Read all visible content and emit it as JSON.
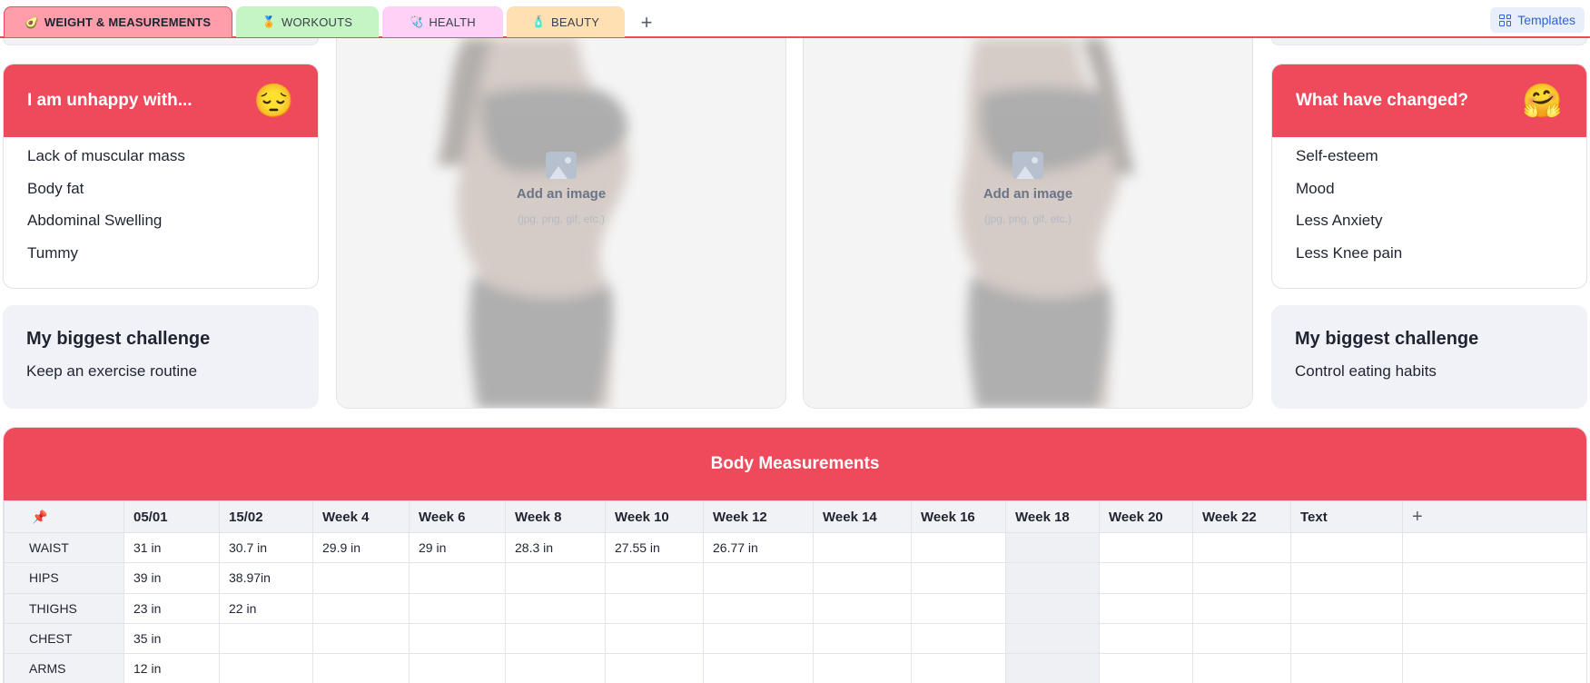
{
  "tabs": [
    {
      "label": "WEIGHT & MEASUREMENTS",
      "icon": "avocado-icon",
      "glyph": "🥑",
      "color": "#ff9dab",
      "active": true
    },
    {
      "label": "WORKOUTS",
      "icon": "medal-icon",
      "glyph": "🏅",
      "color": "#c6f5c5",
      "active": false
    },
    {
      "label": "HEALTH",
      "icon": "stethoscope-icon",
      "glyph": "🩺",
      "color": "#ffd1f6",
      "active": false
    },
    {
      "label": "BEAUTY",
      "icon": "lotion-icon",
      "glyph": "🧴",
      "color": "#ffe0b3",
      "active": false
    }
  ],
  "tab_add": "+",
  "templates_label": "Templates",
  "left": {
    "unhappy": {
      "title": "I am unhappy with...",
      "emoji": "😔",
      "items": [
        "Lack of muscular mass",
        "Body fat",
        "Abdominal Swelling",
        "Tummy"
      ]
    },
    "challenge": {
      "title": "My biggest challenge",
      "text": "Keep an exercise routine"
    }
  },
  "right": {
    "changed": {
      "title": "What have changed?",
      "emoji": "🤗",
      "items": [
        "Self-esteem",
        "Mood",
        "Less Anxiety",
        "Less Knee pain"
      ]
    },
    "challenge": {
      "title": "My biggest challenge",
      "text": "Control eating habits"
    }
  },
  "photo_placeholder": {
    "add": "Add an image",
    "formats": "(jpg, png, gif, etc.)"
  },
  "measurements": {
    "title": "Body Measurements",
    "pin": "📌",
    "columns": [
      "05/01",
      "15/02",
      "Week 4",
      "Week 6",
      "Week 8",
      "Week 10",
      "Week 12",
      "Week 14",
      "Week 16",
      "Week 18",
      "Week 20",
      "Week 22",
      "Text"
    ],
    "add_column": "+",
    "rows": [
      {
        "label": "WAIST",
        "cells": [
          "31 in",
          "30.7 in",
          "29.9 in",
          "29 in",
          "28.3 in",
          "27.55 in",
          "26.77 in",
          "",
          "",
          "",
          "",
          "",
          ""
        ]
      },
      {
        "label": "HIPS",
        "cells": [
          "39 in",
          "38.97in",
          "",
          "",
          "",
          "",
          "",
          "",
          "",
          "",
          "",
          "",
          ""
        ]
      },
      {
        "label": "THIGHS",
        "cells": [
          "23 in",
          "22 in",
          "",
          "",
          "",
          "",
          "",
          "",
          "",
          "",
          "",
          "",
          ""
        ]
      },
      {
        "label": "CHEST",
        "cells": [
          "35 in",
          "",
          "",
          "",
          "",
          "",
          "",
          "",
          "",
          "",
          "",
          "",
          ""
        ]
      },
      {
        "label": "ARMS",
        "cells": [
          "12 in",
          "",
          "",
          "",
          "",
          "",
          "",
          "",
          "",
          "",
          "",
          "",
          ""
        ]
      },
      {
        "label": "",
        "cells": [
          "",
          "",
          "",
          "",
          "",
          "",
          "",
          "",
          "",
          "",
          "",
          "",
          ""
        ]
      }
    ]
  }
}
